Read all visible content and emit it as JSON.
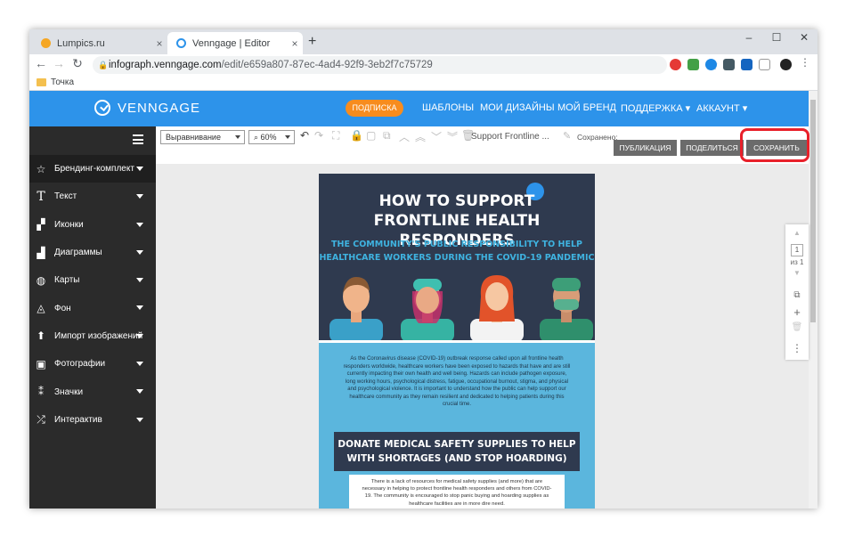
{
  "browser": {
    "tabs": [
      {
        "title": "Lumpics.ru",
        "close": "×",
        "favicon_color": "#f5a623"
      },
      {
        "title": "Venngage | Editor",
        "close": "×",
        "favicon_color": "#2d93ea"
      }
    ],
    "new_tab": "+",
    "window_controls": {
      "minimize": "–",
      "maximize": "☐",
      "close": "✕"
    },
    "url_host": "infograph.venngage.com",
    "url_path": "/edit/e659a807-87ec-4ad4-92f9-3eb2f7c75729",
    "bookmark": "Точка"
  },
  "app": {
    "logo": "VENNGAGE",
    "subscribe": "ПОДПИСКА",
    "nav": [
      "ШАБЛОНЫ",
      "МОИ ДИЗАЙНЫ",
      "МОЙ БРЕНД",
      "ПОДДЕРЖКА ▾",
      "АККАУНТ ▾"
    ]
  },
  "sidebar": {
    "items": [
      {
        "label": "Брендинг-комплект",
        "icon": "☆"
      },
      {
        "label": "Текст",
        "icon": "T"
      },
      {
        "label": "Иконки",
        "icon": "▞"
      },
      {
        "label": "Диаграммы",
        "icon": "▟"
      },
      {
        "label": "Карты",
        "icon": "◍"
      },
      {
        "label": "Фон",
        "icon": "◬"
      },
      {
        "label": "Импорт изображений",
        "icon": "⬆"
      },
      {
        "label": "Фотографии",
        "icon": "▣"
      },
      {
        "label": "Значки",
        "icon": "⁑"
      },
      {
        "label": "Интерактив",
        "icon": "⤮"
      }
    ]
  },
  "editor": {
    "align_select": "Выравнивание",
    "zoom_select": "60%",
    "doc_name": "Support Frontline ...",
    "status": "Сохранено:",
    "publish": "ПУБЛИКАЦИЯ",
    "share": "ПОДЕЛИТЬСЯ",
    "save": "СОХРАНИТЬ"
  },
  "pages": {
    "current": "1",
    "of": "из 1"
  },
  "infographic": {
    "title_line1": "HOW TO SUPPORT",
    "title_line2": "FRONTLINE HEALTH RESPONDERS",
    "subtitle_line1": "THE COMMUNITY'S PUBLIC RESPONSIBILITY TO HELP",
    "subtitle_line2": "HEALTHCARE WORKERS DURING THE COVID-19 PANDEMIC",
    "body": "As the Coronavirus disease (COVID-19) outbreak response called upon all frontline health responders worldwide, healthcare workers have been exposed to hazards that have and are still currently impacting their own health and well being. Hazards can include pathogen exposure, long working hours, psychological distress, fatigue, occupational burnout, stigma, and physical and psychological violence. It is important to understand how the public can help support our healthcare community as they remain resilient and dedicated to helping patients during this crucial time.",
    "banner_line1": "DONATE MEDICAL SAFETY SUPPLIES TO HELP",
    "banner_line2": "WITH SHORTAGES (AND STOP HOARDING)",
    "lower_body": "There is a lack of resources for medical safety supplies (and more) that are necessary in helping to protect frontline health responders and others from COVID-19. The community is encouraged to stop panic buying and hoarding supplies as healthcare facilities are in more dire need."
  }
}
